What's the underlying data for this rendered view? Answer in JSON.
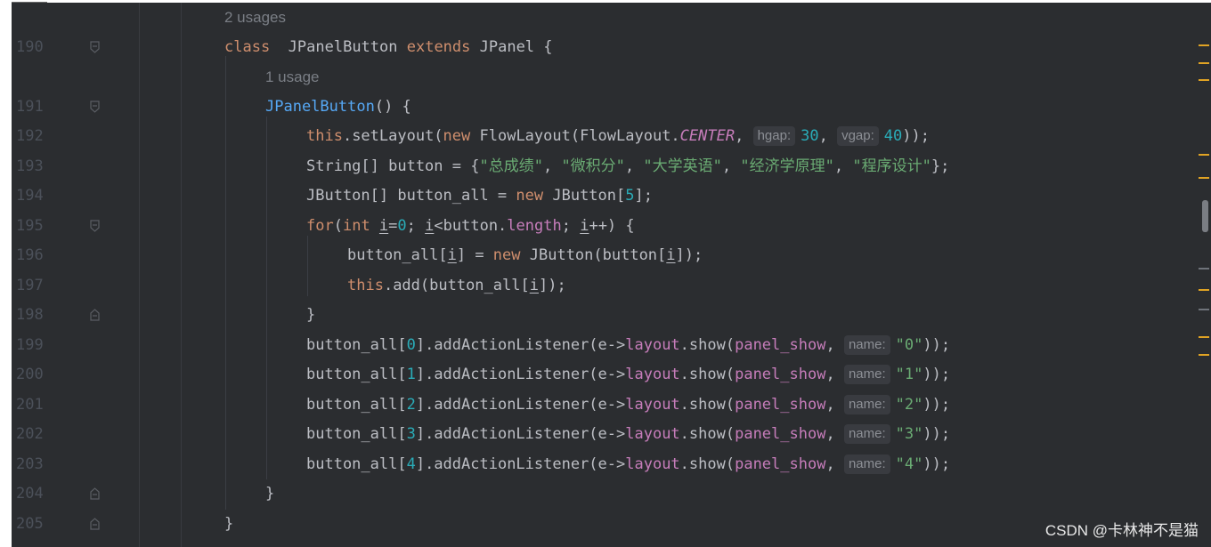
{
  "lines": [
    {
      "ln": "",
      "inlay": "2 usages",
      "indent": 0
    },
    {
      "ln": "190",
      "indent": 0,
      "fold": "open",
      "tokens": [
        [
          "kw",
          "class"
        ],
        [
          "",
          "  "
        ],
        [
          "typ",
          "JPanelButton "
        ],
        [
          "kw",
          "extends "
        ],
        [
          "typ",
          "JPanel {"
        ]
      ]
    },
    {
      "ln": "",
      "inlay": "1 usage",
      "indent": 1
    },
    {
      "ln": "191",
      "indent": 1,
      "fold": "open",
      "tokens": [
        [
          "fn",
          "JPanelButton"
        ],
        [
          "",
          "() {"
        ]
      ]
    },
    {
      "ln": "192",
      "indent": 2,
      "tokens": [
        [
          "kw",
          "this"
        ],
        [
          "",
          ".setLayout("
        ],
        [
          "kw",
          "new "
        ],
        [
          "",
          "FlowLayout(FlowLayout."
        ],
        [
          "it",
          "CENTER"
        ],
        [
          "",
          ", "
        ],
        [
          "hint",
          "hgap:"
        ],
        [
          "num",
          "30"
        ],
        [
          "",
          ", "
        ],
        [
          "hint",
          "vgap:"
        ],
        [
          "num",
          "40"
        ],
        [
          "",
          "));"
        ]
      ]
    },
    {
      "ln": "193",
      "indent": 2,
      "tokens": [
        [
          "",
          "String[] button = {"
        ],
        [
          "str",
          "\"总成绩\""
        ],
        [
          "",
          ", "
        ],
        [
          "str",
          "\"微积分\""
        ],
        [
          "",
          ", "
        ],
        [
          "str",
          "\"大学英语\""
        ],
        [
          "",
          ", "
        ],
        [
          "str",
          "\"经济学原理\""
        ],
        [
          "",
          ", "
        ],
        [
          "str",
          "\"程序设计\""
        ],
        [
          "",
          "};"
        ]
      ]
    },
    {
      "ln": "194",
      "indent": 2,
      "tokens": [
        [
          "",
          "JButton[] button_all = "
        ],
        [
          "kw",
          "new "
        ],
        [
          "",
          "JButton["
        ],
        [
          "num",
          "5"
        ],
        [
          "",
          "];"
        ]
      ]
    },
    {
      "ln": "195",
      "indent": 2,
      "fold": "open",
      "tokens": [
        [
          "kw",
          "for"
        ],
        [
          "",
          "("
        ],
        [
          "kw",
          "int "
        ],
        [
          "ul",
          "i"
        ],
        [
          "",
          "="
        ],
        [
          "num",
          "0"
        ],
        [
          "",
          "; "
        ],
        [
          "ul",
          "i"
        ],
        [
          "",
          "<button."
        ],
        [
          "fld",
          "length"
        ],
        [
          "",
          "; "
        ],
        [
          "ul",
          "i"
        ],
        [
          "",
          "++) {"
        ]
      ]
    },
    {
      "ln": "196",
      "indent": 3,
      "tokens": [
        [
          "",
          "button_all["
        ],
        [
          "ul",
          "i"
        ],
        [
          "",
          "] = "
        ],
        [
          "kw",
          "new "
        ],
        [
          "",
          "JButton(button["
        ],
        [
          "ul",
          "i"
        ],
        [
          "",
          "]);"
        ]
      ]
    },
    {
      "ln": "197",
      "indent": 3,
      "tokens": [
        [
          "kw",
          "this"
        ],
        [
          "",
          ".add(button_all["
        ],
        [
          "ul",
          "i"
        ],
        [
          "",
          "]);"
        ]
      ]
    },
    {
      "ln": "198",
      "indent": 2,
      "fold": "close",
      "tokens": [
        [
          "",
          "}"
        ]
      ]
    },
    {
      "ln": "199",
      "indent": 2,
      "tokens": [
        [
          "",
          "button_all["
        ],
        [
          "num",
          "0"
        ],
        [
          "",
          "].addActionListener(e->"
        ],
        [
          "fld",
          "layout"
        ],
        [
          "",
          ".show("
        ],
        [
          "fld",
          "panel_show"
        ],
        [
          "",
          ", "
        ],
        [
          "hint",
          "name:"
        ],
        [
          "str",
          "\"0\""
        ],
        [
          "",
          "));"
        ]
      ]
    },
    {
      "ln": "200",
      "indent": 2,
      "tokens": [
        [
          "",
          "button_all["
        ],
        [
          "num",
          "1"
        ],
        [
          "",
          "].addActionListener(e->"
        ],
        [
          "fld",
          "layout"
        ],
        [
          "",
          ".show("
        ],
        [
          "fld",
          "panel_show"
        ],
        [
          "",
          ", "
        ],
        [
          "hint",
          "name:"
        ],
        [
          "str",
          "\"1\""
        ],
        [
          "",
          "));"
        ]
      ]
    },
    {
      "ln": "201",
      "indent": 2,
      "tokens": [
        [
          "",
          "button_all["
        ],
        [
          "num",
          "2"
        ],
        [
          "",
          "].addActionListener(e->"
        ],
        [
          "fld",
          "layout"
        ],
        [
          "",
          ".show("
        ],
        [
          "fld",
          "panel_show"
        ],
        [
          "",
          ", "
        ],
        [
          "hint",
          "name:"
        ],
        [
          "str",
          "\"2\""
        ],
        [
          "",
          "));"
        ]
      ]
    },
    {
      "ln": "202",
      "indent": 2,
      "tokens": [
        [
          "",
          "button_all["
        ],
        [
          "num",
          "3"
        ],
        [
          "",
          "].addActionListener(e->"
        ],
        [
          "fld",
          "layout"
        ],
        [
          "",
          ".show("
        ],
        [
          "fld",
          "panel_show"
        ],
        [
          "",
          ", "
        ],
        [
          "hint",
          "name:"
        ],
        [
          "str",
          "\"3\""
        ],
        [
          "",
          "));"
        ]
      ]
    },
    {
      "ln": "203",
      "indent": 2,
      "tokens": [
        [
          "",
          "button_all["
        ],
        [
          "num",
          "4"
        ],
        [
          "",
          "].addActionListener(e->"
        ],
        [
          "fld",
          "layout"
        ],
        [
          "",
          ".show("
        ],
        [
          "fld",
          "panel_show"
        ],
        [
          "",
          ", "
        ],
        [
          "hint",
          "name:"
        ],
        [
          "str",
          "\"4\""
        ],
        [
          "",
          "));"
        ]
      ]
    },
    {
      "ln": "204",
      "indent": 1,
      "fold": "close",
      "tokens": [
        [
          "",
          "}"
        ]
      ]
    },
    {
      "ln": "205",
      "indent": 0,
      "fold": "close",
      "tokens": [
        [
          "",
          "}"
        ]
      ]
    }
  ],
  "watermark": "CSDN @卡林神不是猫",
  "colors": {
    "background": "#2b2d30",
    "keyword": "#cf8e6d",
    "string": "#6aab73",
    "number": "#2aacb8",
    "field": "#c77dbb",
    "method": "#56a8f5",
    "marker": "#e0a324"
  }
}
